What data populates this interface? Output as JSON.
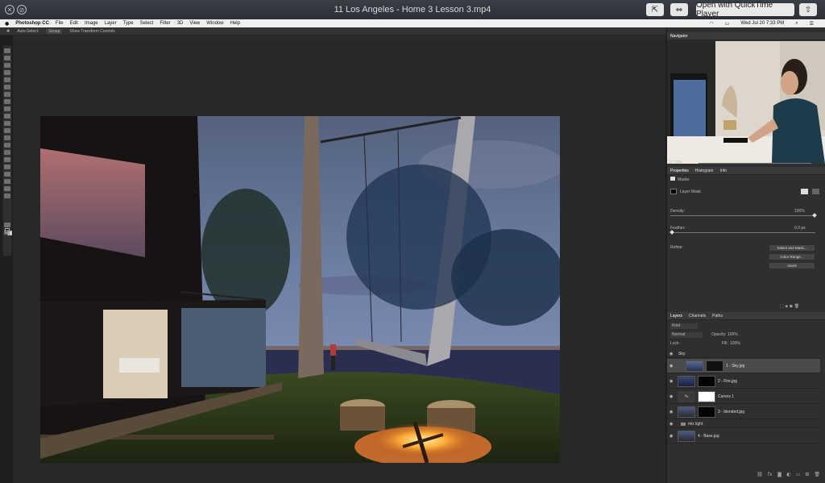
{
  "window": {
    "title": "11 Los Angeles - Home 3 Lesson 3.mp4",
    "open_with": "Open with QuickTime Player"
  },
  "menubar": {
    "app": "Photoshop CC",
    "items": [
      "File",
      "Edit",
      "Image",
      "Layer",
      "Type",
      "Select",
      "Filter",
      "3D",
      "View",
      "Window",
      "Help"
    ],
    "clock": "Wed Jul 20  7:33 PM"
  },
  "options_bar": {
    "auto_select": "Auto-Select:",
    "auto_select_value": "Group",
    "transform": "Show Transform Controls"
  },
  "navigator": {
    "title": "Navigator",
    "zoom": "37.13%"
  },
  "properties": {
    "tabs": [
      "Properties",
      "Histogram",
      "Info"
    ],
    "masks_label": "Masks",
    "layer_mask": "Layer Mask",
    "density_label": "Density:",
    "density_value": "100%",
    "density_pct": 1.0,
    "feather_label": "Feather:",
    "feather_value": "0.0 px",
    "refine_label": "Refine:",
    "buttons": [
      "Select and Mask...",
      "Color Range...",
      "Invert"
    ]
  },
  "layers": {
    "tabs": [
      "Layers",
      "Channels",
      "Paths"
    ],
    "kind": "Kind",
    "blend": "Normal",
    "opacity_label": "Opacity:",
    "opacity_value": "100%",
    "lock_label": "Lock:",
    "fill_label": "Fill:",
    "fill_value": "100%",
    "rows": [
      {
        "name": "Sky",
        "type": "group"
      },
      {
        "name": "1 - Sky.jpg",
        "type": "layer",
        "selected": true
      },
      {
        "name": "2 - Fire.jpg",
        "type": "layer"
      },
      {
        "name": "Curves 1",
        "type": "adjustment"
      },
      {
        "name": "3 - blended.jpg",
        "type": "layer"
      },
      {
        "name": "mix light",
        "type": "group"
      },
      {
        "name": "4 - Base.jpg",
        "type": "layer"
      }
    ]
  },
  "colors": {
    "ui_dark": "#2f2f2f",
    "selected_layer": "#4a4a4a"
  }
}
